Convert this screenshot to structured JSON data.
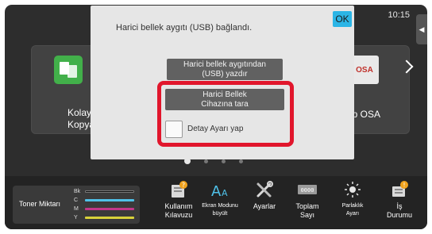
{
  "status": {
    "time": "10:15",
    "side_tab_icon": "chevron-left-icon"
  },
  "tiles": {
    "left": {
      "label_line1": "Kolay",
      "label_line2": "Kopya",
      "icon": "copy-icon"
    },
    "right": {
      "label": "arp OSA",
      "icon_text": "OSA",
      "icon": "sharp-osa-icon"
    },
    "next_icon": "chevron-right-icon"
  },
  "pager": {
    "count": 4,
    "active_index": 0
  },
  "dialog": {
    "message": "Harici bellek aygıtı (USB) bağlandı.",
    "ok_label": "OK",
    "print_button": {
      "line1": "Harici bellek aygıtından",
      "line2": "(USB) yazdır"
    },
    "scan_button": {
      "line1": "Harici Bellek",
      "line2": "Cihazına tara"
    },
    "checkbox_label": "Detay Ayarı yap",
    "checkbox_checked": false
  },
  "toner": {
    "label": "Toner Miktarı",
    "channels": [
      {
        "name": "Bk",
        "color": "#111111"
      },
      {
        "name": "C",
        "color": "#4fc1e9"
      },
      {
        "name": "M",
        "color": "#c2378a"
      },
      {
        "name": "Y",
        "color": "#d8d23a"
      }
    ]
  },
  "bottom_bar": {
    "manual": {
      "line1": "Kullanım",
      "line2": "Kılavuzu",
      "icon": "manual-icon"
    },
    "display_mode": {
      "line1": "Ekran Modunu",
      "line2": "büyült",
      "icon": "font-size-icon"
    },
    "settings": {
      "line1": "Ayarlar",
      "icon": "tools-icon"
    },
    "counter": {
      "line1": "Toplam",
      "line2": "Sayı",
      "icon": "counter-icon",
      "icon_text": "0000"
    },
    "brightness": {
      "line1": "Parlaklık",
      "line2": "Ayarı",
      "icon": "brightness-icon"
    },
    "job_status": {
      "line1": "İş",
      "line2": "Durumu",
      "icon": "job-status-icon"
    }
  },
  "colors": {
    "highlight": "#e1162c",
    "ok_button": "#2bb5e6",
    "accent_orange": "#f0a21c"
  }
}
